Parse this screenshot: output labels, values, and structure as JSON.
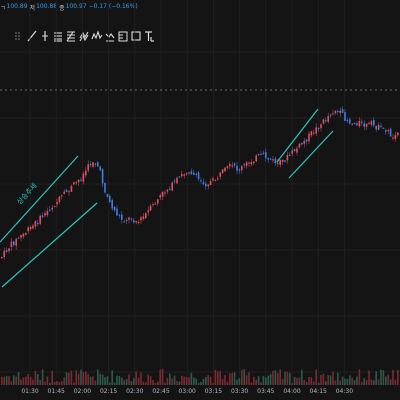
{
  "ohlc_bar": {
    "close_prefix": "ㄱ",
    "close_value": "100.89",
    "low_label": "저",
    "low_value": "100.88",
    "last_label": "종",
    "last_value": "100.97",
    "change": "−0.17 (−0.16%)"
  },
  "toolbar": {
    "tools": [
      {
        "icon": "drag-handle-icon"
      },
      {
        "icon": "trend-line-icon"
      },
      {
        "icon": "vertical-line-icon"
      },
      {
        "icon": "horizontal-lines-icon"
      },
      {
        "icon": "fib-retracement-icon"
      },
      {
        "icon": "channel-icon"
      },
      {
        "icon": "pattern-icon"
      },
      {
        "icon": "ellipse-zigzag-icon"
      },
      {
        "icon": "ruler-icon"
      },
      {
        "icon": "rectangle-icon"
      },
      {
        "icon": "text-icon"
      }
    ]
  },
  "annotation": {
    "label": "상승추세",
    "line_color": "#2ec4c4"
  },
  "colors": {
    "up": "#e0505f",
    "down": "#3f7ee8",
    "background": "#141414",
    "grid": "#232323",
    "price_line": "#8a8a8a"
  },
  "time_axis": [
    "01:30",
    "01:45",
    "02:00",
    "02:15",
    "02:30",
    "02:45",
    "03:00",
    "03:15",
    "03:30",
    "03:45",
    "04:00",
    "04:15",
    "04:30"
  ],
  "chart_data": {
    "type": "candlestick",
    "x_ticks": [
      "01:30",
      "01:45",
      "02:00",
      "02:15",
      "02:30",
      "02:45",
      "03:00",
      "03:15",
      "03:30",
      "03:45",
      "04:00",
      "04:15",
      "04:30"
    ],
    "grid": true,
    "overlays": [
      "ascending channel (pink/cyan) 01:20–02:05",
      "ascending channel 03:45–04:00",
      "dashed horizontal price line"
    ],
    "volume": true
  }
}
